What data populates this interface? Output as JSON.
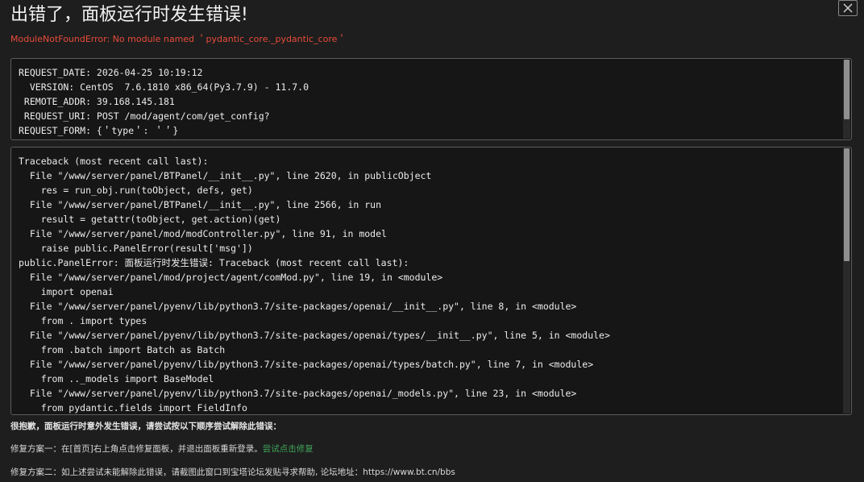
{
  "title": "出错了，面板运行时发生错误!",
  "error_message": "ModuleNotFoundError: No module named ＇pydantic_core._pydantic_core＇",
  "request_info": [
    "REQUEST_DATE: 2026-04-25 10:19:12",
    "  VERSION: CentOS  7.6.1810 x86_64(Py3.7.9) - 11.7.0",
    " REMOTE_ADDR: 39.168.145.181",
    " REQUEST_URI: POST /mod/agent/com/get_config?",
    "REQUEST_FORM: {＇type＇: ＇＇}"
  ],
  "traceback": [
    "Traceback (most recent call last):",
    "  File \"/www/server/panel/BTPanel/__init__.py\", line 2620, in publicObject",
    "    res = run_obj.run(toObject, defs, get)",
    "  File \"/www/server/panel/BTPanel/__init__.py\", line 2566, in run",
    "    result = getattr(toObject, get.action)(get)",
    "  File \"/www/server/panel/mod/modController.py\", line 91, in model",
    "    raise public.PanelError(result['msg'])",
    "public.PanelError: 面板运行时发生错误: Traceback (most recent call last):",
    "  File \"/www/server/panel/mod/project/agent/comMod.py\", line 19, in <module>",
    "    import openai",
    "  File \"/www/server/panel/pyenv/lib/python3.7/site-packages/openai/__init__.py\", line 8, in <module>",
    "    from . import types",
    "  File \"/www/server/panel/pyenv/lib/python3.7/site-packages/openai/types/__init__.py\", line 5, in <module>",
    "    from .batch import Batch as Batch",
    "  File \"/www/server/panel/pyenv/lib/python3.7/site-packages/openai/types/batch.py\", line 7, in <module>",
    "    from .._models import BaseModel",
    "  File \"/www/server/panel/pyenv/lib/python3.7/site-packages/openai/_models.py\", line 23, in <module>",
    "    from pydantic.fields import FieldInfo"
  ],
  "notes": {
    "sorry": "很抱歉，面板运行时意外发生错误，请尝试按以下顺序尝试解除此错误：",
    "fix1_text": "修复方案一：在[首页]右上角点击修复面板，并退出面板重新登录。",
    "fix1_link": "尝试点击修复",
    "fix2_text": "修复方案二：如上述尝试未能解除此错误，请截图此窗口到宝塔论坛发贴寻求帮助, 论坛地址：https://www.bt.cn/bbs"
  },
  "icons": {
    "close": "close-icon"
  },
  "colors": {
    "background": "#1e1e1e",
    "error": "#e84b3a",
    "link": "#3fa45a"
  }
}
